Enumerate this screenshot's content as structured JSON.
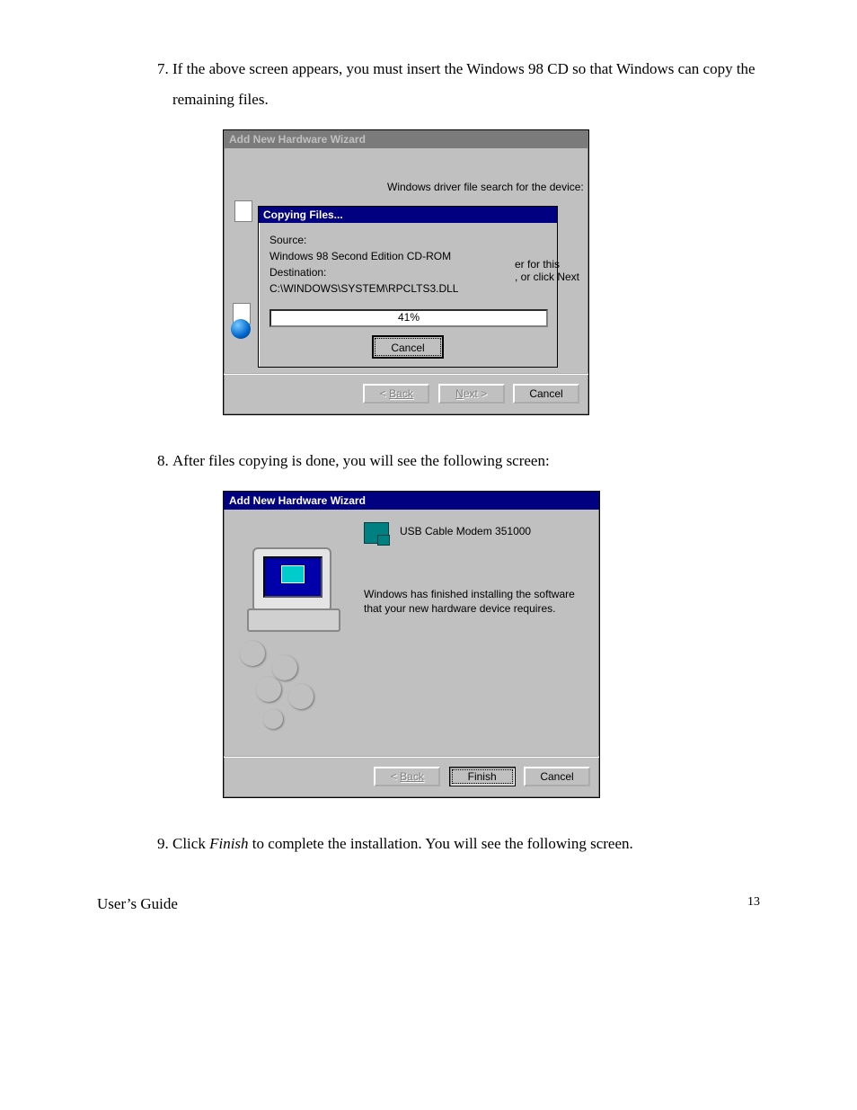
{
  "steps": {
    "s7": "If the above screen appears, you must insert the Windows 98 CD so that Windows can copy the remaining files.",
    "s8": "After files copying is done,  you will see the following screen:",
    "s9_a": "Click ",
    "s9_b": "Finish",
    "s9_c": " to complete the installation.  You will see the following screen."
  },
  "dialog1": {
    "title": "Add New Hardware Wizard",
    "top_text": "Windows driver file search for the device:",
    "copy_title": "Copying Files...",
    "source_label": "Source:",
    "source_value": "Windows 98 Second Edition CD-ROM",
    "dest_label": "Destination:",
    "dest_value": "C:\\WINDOWS\\SYSTEM\\RPCLTS3.DLL",
    "progress": "41%",
    "cancel_inner": "Cancel",
    "side_line1": "er for this",
    "side_line2": ", or click Next",
    "back": "Back",
    "next": "Next >",
    "cancel": "Cancel"
  },
  "dialog2": {
    "title": "Add New Hardware Wizard",
    "device": "USB Cable Modem 351000",
    "message": "Windows has finished installing the software that your new hardware device requires.",
    "back": "Back",
    "finish": "Finish",
    "cancel": "Cancel"
  },
  "footer": {
    "left": "User’s Guide",
    "right": "13"
  }
}
